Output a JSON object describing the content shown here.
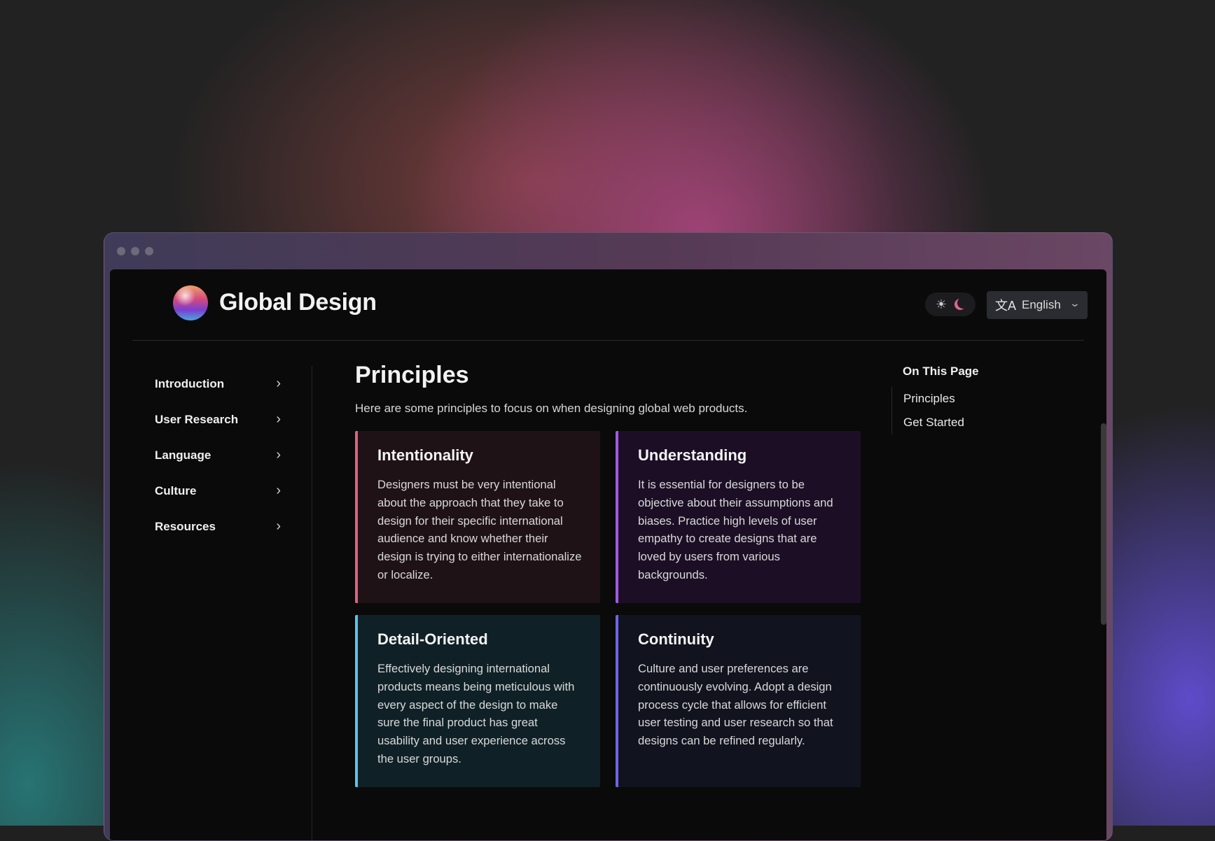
{
  "site": {
    "brand": "Global Design"
  },
  "header": {
    "theme_icons": {
      "light": "sun-icon",
      "dark": "moon-icon"
    },
    "language": {
      "icon": "translate-icon",
      "value": "English",
      "chevron": "chevron-down-icon"
    }
  },
  "sidebar": {
    "items": [
      {
        "label": "Introduction",
        "icon": "chevron-right-icon"
      },
      {
        "label": "User Research",
        "icon": "chevron-right-icon"
      },
      {
        "label": "Language",
        "icon": "chevron-right-icon"
      },
      {
        "label": "Culture",
        "icon": "chevron-right-icon"
      },
      {
        "label": "Resources",
        "icon": "chevron-right-icon"
      }
    ]
  },
  "main": {
    "title": "Principles",
    "intro": "Here are some principles to focus on when designing global web products.",
    "cards": [
      {
        "title": "Intentionality",
        "body": "Designers must be very intentional about the approach that they take to design for their specific international audience and know whether their design is trying to either internationalize or localize.",
        "accent": "#e0607e",
        "bg": "#1f1216"
      },
      {
        "title": "Understanding",
        "body": "It is essential for designers to be objective about their assumptions and biases. Practice high levels of user empathy to create designs that are loved by users from various backgrounds.",
        "accent": "#a15ae6",
        "bg": "#1c0f25"
      },
      {
        "title": "Detail-Oriented",
        "body": "Effectively designing international products means being meticulous with every aspect of the design to make sure the final product has great usability and user experience across the user groups.",
        "accent": "#5cc3e8",
        "bg": "#0f2127"
      },
      {
        "title": "Continuity",
        "body": "Culture and user preferences are continuously evolving. Adopt a design process cycle that allows for efficient user testing and user research so that designs can be refined regularly.",
        "accent": "#6f64e8",
        "bg": "#11131f"
      }
    ]
  },
  "toc": {
    "title": "On This Page",
    "links": [
      "Principles",
      "Get Started"
    ]
  }
}
